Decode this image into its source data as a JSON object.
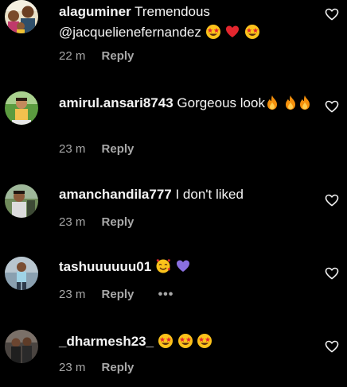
{
  "colors": {
    "background": "#000000",
    "text": "#f5f5f5",
    "secondary": "#a8a8a8"
  },
  "icons": {
    "like": "heart-outline-icon",
    "more": "more-horizontal-icon"
  },
  "comments": [
    {
      "username": "alaguminer",
      "text": "Tremendous @jacquelienefernandez",
      "emojis": [
        "star-struck",
        "red-heart",
        "star-struck"
      ],
      "time": "22 m",
      "reply": "Reply"
    },
    {
      "username": "amirul.ansari8743",
      "text": "Gorgeous look",
      "emojis": [
        "fire",
        "fire",
        "fire"
      ],
      "time": "23 m",
      "reply": "Reply"
    },
    {
      "username": "amanchandila777",
      "text": "I don't liked",
      "emojis": [],
      "time": "23 m",
      "reply": "Reply"
    },
    {
      "username": "tashuuuuuu01",
      "text": "",
      "emojis": [
        "smiling-face-with-hearts",
        "purple-heart"
      ],
      "time": "23 m",
      "reply": "Reply",
      "more": "•••"
    },
    {
      "username": "_dharmesh23_",
      "text": "",
      "emojis": [
        "star-struck",
        "star-struck",
        "star-struck"
      ],
      "time": "23 m",
      "reply": "Reply"
    }
  ]
}
